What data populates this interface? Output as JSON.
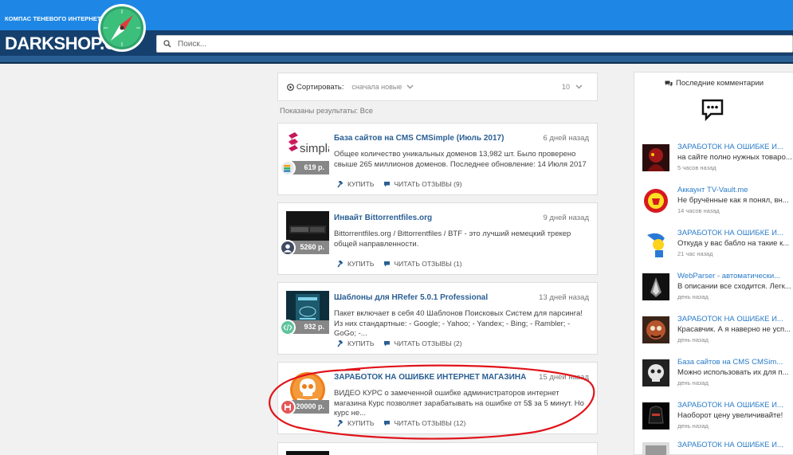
{
  "header": {
    "tagline": "КОМПАС ТЕНЕВОГО ИНТЕРНЕТА",
    "brand": "DARKSHOP.CC",
    "search_placeholder": "Поиск...",
    "colors": {
      "top": "#1e87e5",
      "nav": "#15406e"
    }
  },
  "sort": {
    "label": "Сортировать:",
    "value": "сначала новые",
    "count": "10"
  },
  "results_label": "Показаны результаты: Все",
  "products": [
    {
      "title": "База сайтов на CMS CMSimple (Июль 2017)",
      "date": "6 дней назад",
      "desc": "Общее количество уникальных доменов 13,982 шт. Было проверено свыше 265 миллионов доменов. Последнее обновление: 14 Июля 2017",
      "price": "619 р.",
      "logo_text": "simpla",
      "buy": "КУПИТЬ",
      "reviews": "ЧИТАТЬ ОТЗЫВЫ (9)"
    },
    {
      "title": "Инвайт Bittorrentfiles.org",
      "date": "9 дней назад",
      "desc": "Bittorrentfiles.org / Bittorrentfiles / BTF - это лучший немецкий трекер общей направленности.",
      "price": "5260 р.",
      "buy": "КУПИТЬ",
      "reviews": "ЧИТАТЬ ОТЗЫВЫ (1)"
    },
    {
      "title": "Шаблоны для HRefer 5.0.1 Professional",
      "date": "13 дней назад",
      "desc": "Пакет включает в себя 40 Шаблонов Поисковых Систем для парсинга! Из них стандартные: - Google; - Yahoo; - Yandex; - Bing; - Rambler; - GoGo; -...",
      "price": "932 р.",
      "buy": "КУПИТЬ",
      "reviews": "ЧИТАТЬ ОТЗЫВЫ (2)"
    },
    {
      "title": "ЗАРАБОТОК НА ОШИБКЕ ИНТЕРНЕТ МАГАЗИНА",
      "date": "15 дней назад",
      "desc": "ВИДЕО КУРС о замеченной ошибке администраторов интернет магазина Курс позволяет зарабатывать на ошибке от 5$ за 5 минут. Но курс не...",
      "price": "20000 р.",
      "buy": "КУПИТЬ",
      "reviews": "ЧИТАТЬ ОТЗЫВЫ (12)"
    }
  ],
  "sidebar": {
    "heading": "Последние комментарии",
    "comments": [
      {
        "title": "ЗАРАБОТОК НА ОШИБКЕ И...",
        "text": "на сайте полно нужных товаро...",
        "when": "5 часов назад"
      },
      {
        "title": "Аккаунт TV-Vault.me",
        "text": "Не бручённые как я понял, вн...",
        "when": "14 часов назад"
      },
      {
        "title": "ЗАРАБОТОК НА ОШИБКЕ И...",
        "text": "Откуда у вас бабло на такие к...",
        "when": "21 час назад"
      },
      {
        "title": "WebParser - автоматически...",
        "text": "В описании все сходится. Легк...",
        "when": "день назад"
      },
      {
        "title": "ЗАРАБОТОК НА ОШИБКЕ И...",
        "text": "Красавчик. А я наверно не усп...",
        "when": "день назад"
      },
      {
        "title": "База сайтов на CMS CMSim...",
        "text": "Можно использовать их для п...",
        "when": "день назад"
      },
      {
        "title": "ЗАРАБОТОК НА ОШИБКЕ И...",
        "text": "Наоборот цену увеличивайте!",
        "when": "день назад"
      },
      {
        "title": "ЗАРАБОТОК НА ОШИБКЕ И...",
        "text": "",
        "when": ""
      }
    ]
  }
}
